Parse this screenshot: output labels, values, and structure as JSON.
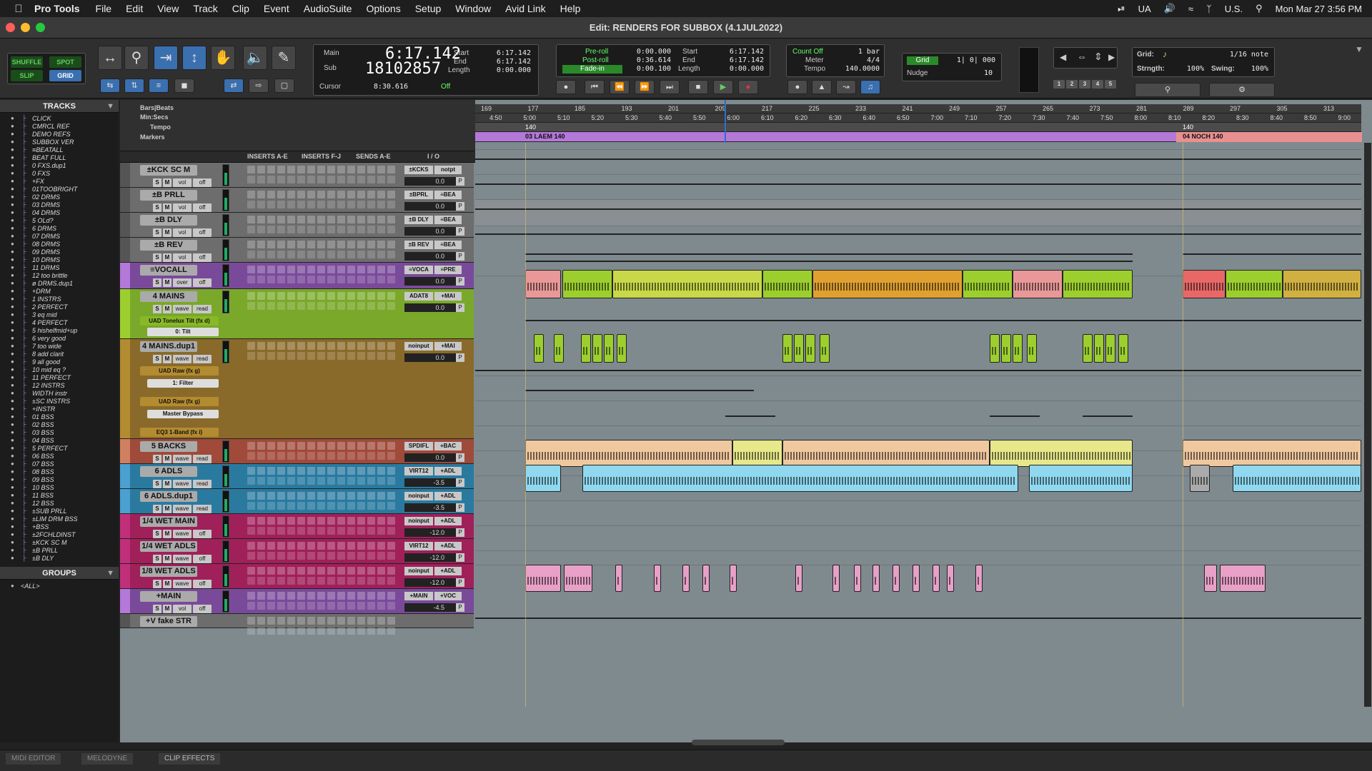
{
  "menubar": {
    "app": "Pro Tools",
    "menus": [
      "File",
      "Edit",
      "View",
      "Track",
      "Clip",
      "Event",
      "AudioSuite",
      "Options",
      "Setup",
      "Window",
      "Avid Link",
      "Help"
    ],
    "status_ua": "UA",
    "input_source": "U.S.",
    "datetime": "Mon Mar 27  3:56 PM"
  },
  "window": {
    "title": "Edit: RENDERS FOR SUBBOX (4.1JUL2022)"
  },
  "toolbar": {
    "modes": [
      "SHUFFLE",
      "SPOT",
      "SLIP",
      "GRID"
    ],
    "counter": {
      "main_label": "Main",
      "main_value": "6:17.142",
      "sub_label": "Sub",
      "sub_value": "18102857",
      "cursor_label": "Cursor",
      "cursor_value": "8:30.616",
      "off_label": "Off",
      "start_label": "Start",
      "start_value": "6:17.142",
      "end_label": "End",
      "end_value": "6:17.142",
      "length_label": "Length",
      "length_value": "0:00.000"
    },
    "transport": {
      "preroll_label": "Pre-roll",
      "preroll_value": "0:00.000",
      "postroll_label": "Post-roll",
      "postroll_value": "0:36.614",
      "fadein_label": "Fade-in",
      "fadein_value": "0:00.100",
      "start_label": "Start",
      "start_value": "6:17.142",
      "end_label": "End",
      "end_value": "6:17.142",
      "length_label": "Length",
      "length_value": "0:00.000"
    },
    "midi": {
      "countoff_label": "Count Off",
      "countoff_value": "1 bar",
      "meter_label": "Meter",
      "meter_value": "4/4",
      "tempo_label": "Tempo",
      "tempo_value": "140.0000"
    },
    "grid_value": "1| 0| 000",
    "grid_label": "Grid",
    "nudge_label": "Nudge",
    "nudge_value": "10",
    "zoom_presets": [
      "1",
      "2",
      "3",
      "4",
      "5"
    ],
    "grid_panel": {
      "grid_label": "Grid:",
      "grid_value": "1/16 note",
      "strength_label": "Strngth:",
      "strength_value": "100%",
      "swing_label": "Swing:",
      "swing_value": "100%"
    }
  },
  "tracks_panel": {
    "title": "TRACKS",
    "items": [
      "CLICK",
      "CMRCL REF",
      "DEMO REFS",
      "SUBBOX VER",
      "≡BEATALL",
      "BEAT FULL",
      "0 FXS.dup1",
      "0 FXS",
      "+FX",
      "01TOOBRIGHT",
      "02 DRMS",
      "03 DRMS",
      "04 DRMS",
      "5 OLd?",
      "6 DRMS",
      "07 DRMS",
      "08 DRMS",
      "09 DRMS",
      "10 DRMS",
      "11 DRMS",
      "12 too brittle",
      "ø DRMS.dup1",
      "+DRM",
      "1 INSTRS",
      "2 PERFECT",
      "3 eq mid",
      "4 PERFECT",
      "5 hishelfmid+up",
      "6 very good",
      "7 too wide",
      "8 add clarit",
      "9 all good",
      "10 mid eq ?",
      "11 PERFECT",
      "12 INSTRS",
      "WIDTH instr",
      "±SC INSTRS",
      "+INSTR",
      "01 BSS",
      "02 BSS",
      "03 BSS",
      "04 BSS",
      "5 PERFECT",
      "06 BSS",
      "07 BSS",
      "08 BSS",
      "09 BSS",
      "10 BSS",
      "11 BSS",
      "12 BSS",
      "±SUB PRLL",
      "±LIM DRM BSS",
      "+BSS",
      "±2FCHLDINST",
      "±KCK SC M",
      "±B PRLL",
      "±B DLY"
    ]
  },
  "groups_panel": {
    "title": "GROUPS",
    "items": [
      "<ALL>"
    ]
  },
  "rulers": {
    "bars_label": "Bars|Beats",
    "minsecs_label": "Min:Secs",
    "tempo_label": "Tempo",
    "markers_label": "Markers",
    "bars": [
      "169",
      "177",
      "185",
      "193",
      "201",
      "209",
      "217",
      "225",
      "233",
      "241",
      "249",
      "257",
      "265",
      "273",
      "281",
      "289",
      "297",
      "305",
      "313"
    ],
    "times": [
      "4:50",
      "5:00",
      "5:10",
      "5:20",
      "5:30",
      "5:40",
      "5:50",
      "6:00",
      "6:10",
      "6:20",
      "6:30",
      "6:40",
      "6:50",
      "7:00",
      "7:10",
      "7:20",
      "7:30",
      "7:40",
      "7:50",
      "8:00",
      "8:10",
      "8:20",
      "8:30",
      "8:40",
      "8:50",
      "9:00"
    ],
    "tempo_marks": [
      "140",
      "140"
    ],
    "markers": [
      "03 LAEM 140",
      "04 NOCH 140"
    ]
  },
  "column_headers": [
    "INSERTS A-E",
    "INSERTS F-J",
    "SENDS A-E",
    "I / O"
  ],
  "edit_tracks": [
    {
      "name": "±KCK SC M",
      "io1": "±KCKS",
      "io2": "notpt",
      "vol": "0.0",
      "mode": "vol"
    },
    {
      "name": "±B PRLL",
      "io1": "±BPRL",
      "io2": "≡BEA",
      "vol": "0.0",
      "mode": "vol"
    },
    {
      "name": "±B DLY",
      "io1": "±B DLY",
      "io2": "≡BEA",
      "vol": "0.0",
      "mode": "vol"
    },
    {
      "name": "±B REV",
      "io1": "±B REV",
      "io2": "≡BEA",
      "vol": "0.0",
      "mode": "vol"
    },
    {
      "name": "≡VOCALL",
      "io1": "≡VOCA",
      "io2": "≡PRE",
      "vol": "0.0",
      "mode": "over"
    },
    {
      "name": "4 MAINS",
      "io1": "ADAT8",
      "io2": "+MAI",
      "vol": "0.0",
      "mode": "wave",
      "auto": "read",
      "plugin": "UAD Tonelux Tilt (fx d)",
      "param": "0: Tilt"
    },
    {
      "name": "4 MAINS.dup1",
      "io1": "noinput",
      "io2": "+MAI",
      "vol": "0.0",
      "mode": "wave",
      "auto": "read",
      "plugins": [
        "UAD Raw (fx g)",
        "UAD Raw (fx g)",
        "EQ3 1-Band (fx i)"
      ],
      "params": [
        "1: Filter",
        "Master Bypass",
        "Master Bypass"
      ]
    },
    {
      "name": "5 BACKS",
      "io1": "SPDIFL",
      "io2": "+BAC",
      "vol": "0.0",
      "mode": "wave",
      "auto": "read"
    },
    {
      "name": "6 ADLS",
      "io1": "VIRT12",
      "io2": "+ADL",
      "vol": "-3.5",
      "mode": "wave",
      "auto": "read"
    },
    {
      "name": "6 ADLS.dup1",
      "io1": "noinput",
      "io2": "+ADL",
      "vol": "-3.5",
      "mode": "wave",
      "auto": "read"
    },
    {
      "name": "1/4 WET MAIN",
      "io1": "noinput",
      "io2": "+ADL",
      "vol": "-12.0",
      "mode": "wave",
      "auto": "off"
    },
    {
      "name": "1/4 WET ADLS",
      "io1": "VIRT12",
      "io2": "+ADL",
      "vol": "-12.0",
      "mode": "wave",
      "auto": "off"
    },
    {
      "name": "1/8 WET ADLS",
      "io1": "noinput",
      "io2": "+ADL",
      "vol": "-12.0",
      "mode": "wave",
      "auto": "off"
    },
    {
      "name": "+MAIN",
      "io1": "+MAIN",
      "io2": "+VOC",
      "vol": "-4.5",
      "mode": "vol",
      "auto": "off"
    },
    {
      "name": "+V fake STR",
      "io1": "",
      "io2": "",
      "vol": "",
      "mode": ""
    }
  ],
  "bottom_tabs": [
    "MIDI EDITOR",
    "MELODYNE",
    "CLIP EFFECTS"
  ],
  "colors": {
    "vocal_green": "#9ccf2e",
    "mains_brown": "#8a6a2a",
    "backs_peach": "#f0c8a0",
    "backs_yellow": "#e6e88a",
    "adls_blue": "#8fd8f0",
    "wet_pink": "#e8a0c8",
    "marker_purple": "#b478d8",
    "track_blue": "#4aa0d0",
    "track_magenta": "#c0307a"
  }
}
